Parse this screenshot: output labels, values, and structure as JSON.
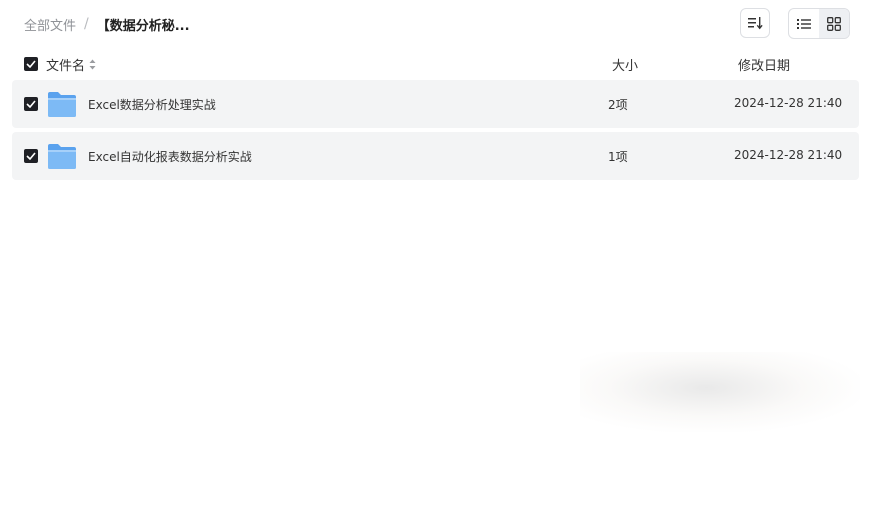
{
  "breadcrumb": {
    "root": "全部文件",
    "separator": "/",
    "current": "【数据分析秘..."
  },
  "toolbar": {
    "sort_icon": "sort-icon",
    "list_view_icon": "list-view-icon",
    "grid_view_icon": "grid-view-icon"
  },
  "table": {
    "columns": {
      "name": "文件名",
      "size": "大小",
      "modified": "修改日期"
    },
    "rows": [
      {
        "name": "Excel数据分析处理实战",
        "size": "2项",
        "modified": "2024-12-28 21:40",
        "checked": true,
        "icon": "folder-icon"
      },
      {
        "name": "Excel自动化报表数据分析实战",
        "size": "1项",
        "modified": "2024-12-28 21:40",
        "checked": true,
        "icon": "folder-icon"
      }
    ]
  },
  "colors": {
    "checkbox": "#1f2025",
    "row_background": "#f3f4f5",
    "folder": "#6bb1f3"
  }
}
